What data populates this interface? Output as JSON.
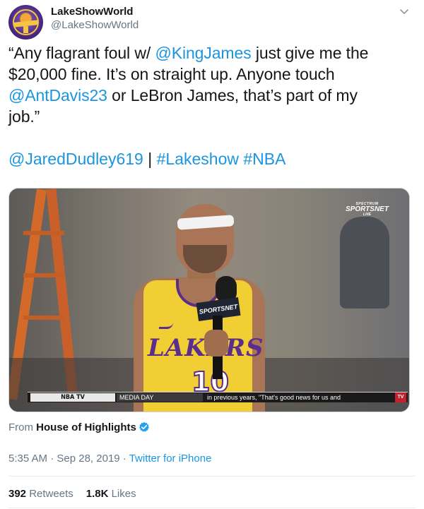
{
  "author": {
    "name": "LakeShowWorld",
    "handle": "@LakeShowWorld"
  },
  "tweet": {
    "lines": [
      [
        "“Any flagrant foul w/ ",
        "@KingJames",
        " just give me the"
      ],
      [
        "$20,000 fine. It’s on straight up. Anyone touch"
      ],
      [
        "@AntDavis23",
        " or LeBron James, that’s part of my"
      ],
      [
        "job.”"
      ]
    ],
    "tags": {
      "mention": "@JaredDudley619",
      "separator": " | ",
      "hashtag1": "#Lakeshow",
      "hashtag2": "#NBA"
    }
  },
  "video": {
    "logo_small": "SPECTRUM",
    "logo_big": "SPORTSNET",
    "logo_sub": "LIVE",
    "jersey_word": "LAKERS",
    "jersey_number": "10",
    "mic_flag": "SPORTSNET",
    "ticker": {
      "segment1": "NBA TV",
      "segment2": "MEDIA DAY",
      "segment3": "in previous years, \"That's good news for us and",
      "logo": "TV"
    }
  },
  "source": {
    "prefix": "From ",
    "name": "House of Highlights"
  },
  "meta": {
    "time": "5:35 AM",
    "dot": " · ",
    "date": "Sep 28, 2019",
    "client": "Twitter for iPhone"
  },
  "stats": {
    "retweets_count": "392",
    "retweets_label": "Retweets",
    "likes_count": "1.8K",
    "likes_label": "Likes"
  },
  "colors": {
    "link": "#1b95e0",
    "text": "#14171a",
    "muted": "#657786",
    "divider": "#e6ecf0"
  },
  "icons": [
    "caret-down-icon",
    "verified-badge-icon"
  ]
}
